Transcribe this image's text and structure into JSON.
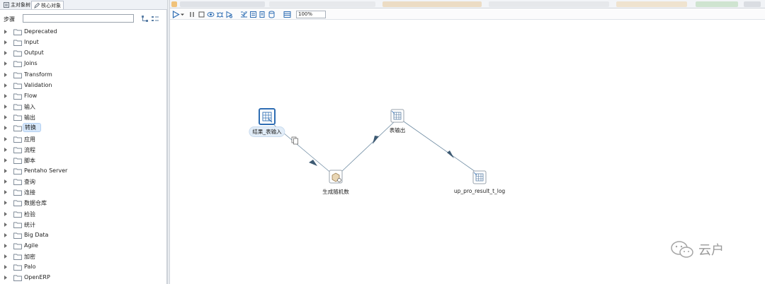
{
  "left_panel": {
    "tabs": [
      "主对象树",
      "核心对象"
    ],
    "steps_label": "步骤",
    "search": {
      "value": "",
      "placeholder": ""
    },
    "tree_items": [
      {
        "label": "Deprecated"
      },
      {
        "label": "Input"
      },
      {
        "label": "Output"
      },
      {
        "label": "Joins"
      },
      {
        "label": "Transform"
      },
      {
        "label": "Validation"
      },
      {
        "label": "Flow"
      },
      {
        "label": "输入"
      },
      {
        "label": "输出"
      },
      {
        "label": "转换",
        "selected": true
      },
      {
        "label": "应用"
      },
      {
        "label": "流程"
      },
      {
        "label": "脚本"
      },
      {
        "label": "Pentaho Server"
      },
      {
        "label": "查询"
      },
      {
        "label": "连接"
      },
      {
        "label": "数据仓库"
      },
      {
        "label": "检验"
      },
      {
        "label": "统计"
      },
      {
        "label": "Big Data"
      },
      {
        "label": "Agile"
      },
      {
        "label": "加密"
      },
      {
        "label": "Palo"
      },
      {
        "label": "OpenERP"
      }
    ]
  },
  "toolbar": {
    "zoom": "100%"
  },
  "canvas": {
    "nodes": [
      {
        "id": "n1",
        "label": "结果_表输入",
        "icon": "table-input-icon",
        "selected": true
      },
      {
        "id": "n2",
        "label": "生成随机数",
        "icon": "random-generator-icon"
      },
      {
        "id": "n3",
        "label": "表输出",
        "icon": "table-output-icon"
      },
      {
        "id": "n4",
        "label": "up_pro_result_t_log",
        "icon": "table-output-icon"
      }
    ]
  },
  "watermark": {
    "text": "云户",
    "icon": "wechat-icon"
  },
  "colors": {
    "accent": "#2e6db3",
    "hop": "#6f8ca3",
    "folder": "#7c8896"
  }
}
